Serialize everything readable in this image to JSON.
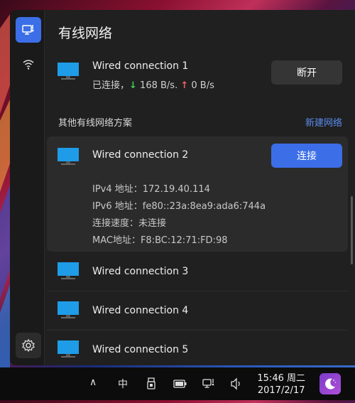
{
  "sidebar": {
    "items": [
      {
        "icon": "wired-network-icon",
        "active": true
      },
      {
        "icon": "wifi-icon",
        "active": false
      }
    ],
    "settings_icon": "gear-icon"
  },
  "header": {
    "title": "有线网络"
  },
  "current": {
    "name": "Wired connection 1",
    "status_prefix": "已连接，",
    "down_arrow": "↓",
    "down_speed": " 168 B/s.",
    "up_arrow": "↑",
    "up_speed": " 0 B/s",
    "button_label": "断开"
  },
  "others": {
    "section_title": "其他有线网络方案",
    "new_link": "新建网络",
    "expanded": {
      "name": "Wired connection 2",
      "button_label": "连接",
      "ipv4": "IPv4 地址：172.19.40.114",
      "ipv6": "IPv6 地址：fe80::23a:8ea9:ada6:744a",
      "speed": "连接速度：未连接",
      "mac": "MAC地址：F8:BC:12:71:FD:98"
    },
    "list": [
      {
        "name": "Wired connection 3"
      },
      {
        "name": "Wired connection 4"
      },
      {
        "name": "Wired connection 5"
      }
    ]
  },
  "taskbar": {
    "chevron": "∧",
    "ime": "中",
    "time": "15:46 周二",
    "date": "2017/2/17"
  },
  "colors": {
    "accent": "#3c6ee8",
    "link": "#5a8cf0",
    "download": "#3fcf5a",
    "upload": "#f06060"
  }
}
